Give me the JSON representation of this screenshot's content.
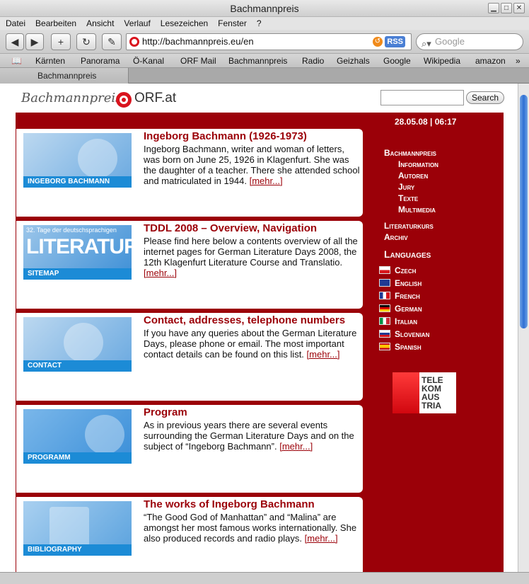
{
  "window": {
    "title": "Bachmannpreis"
  },
  "menu": [
    "Datei",
    "Bearbeiten",
    "Ansicht",
    "Verlauf",
    "Lesezeichen",
    "Fenster",
    "?"
  ],
  "toolbar": {
    "url": "http://bachmannpreis.eu/en",
    "rss": "RSS",
    "search_placeholder": "Google"
  },
  "bookmarks": [
    "Kärnten",
    "Panorama",
    "Ö-Kanal",
    "ORF Mail",
    "Bachmannpreis",
    "Radio",
    "Geizhals",
    "Google",
    "Wikipedia",
    "amazon"
  ],
  "tab": {
    "title": "Bachmannpreis"
  },
  "site": {
    "logo_text": "Bachmannpreis",
    "orf": "ORF.at",
    "search_button": "Search",
    "date": "28.05.08 | 06:17"
  },
  "articles": [
    {
      "title": "Ingeborg Bachmann (1926-1973)",
      "thumb": "INGEBORG BACHMANN",
      "body": "Ingeborg Bachmann, writer and woman of letters, was born on June 25, 1926 in Klagenfurt. She was the daughter of a teacher. There she attended school and matriculated in 1944.",
      "more": "[mehr...]"
    },
    {
      "title": "TDDL 2008 – Overview, Navigation",
      "thumb": "SITEMAP",
      "thumb_small": "32. Tage der deutschsprachigen",
      "thumb_big": "LITERATUR",
      "body": "Please find here below a contents overview of all the internet pages for German Literature Days 2008, the 12th Klagenfurt Literature Course and Translatio.",
      "more": "[mehr...]"
    },
    {
      "title": "Contact, addresses, telephone numbers",
      "thumb": "CONTACT",
      "body": "If you have any queries about the German Literature Days, please phone or email. The most important contact details can be found on this list.",
      "more": "[mehr...]"
    },
    {
      "title": "Program",
      "thumb": "PROGRAMM",
      "body": "As in previous years there are several events surrounding the German Literature Days and on the subject of “Ingeborg Bachmann”.",
      "more": "[mehr...]"
    },
    {
      "title": "The works of Ingeborg Bachmann",
      "thumb": "BIBLIOGRAPHY",
      "body": "“The Good God of Manhattan” and “Malina” are amongst her most famous works internationally. She also produced records and radio plays.",
      "more": "[mehr...]"
    }
  ],
  "nav": {
    "main": "Bachmannpreis",
    "sub": [
      "Information",
      "Autoren",
      "Jury",
      "Texte",
      "Multimedia"
    ],
    "extra": [
      "Literaturkurs",
      "Archiv"
    ]
  },
  "languages": {
    "heading": "Languages",
    "items": [
      "Czech",
      "English",
      "French",
      "German",
      "Italian",
      "Slovenian",
      "Spanish"
    ]
  },
  "sponsor": {
    "lines": [
      "TELE",
      "KOM",
      "AUS",
      "TRIA"
    ]
  }
}
